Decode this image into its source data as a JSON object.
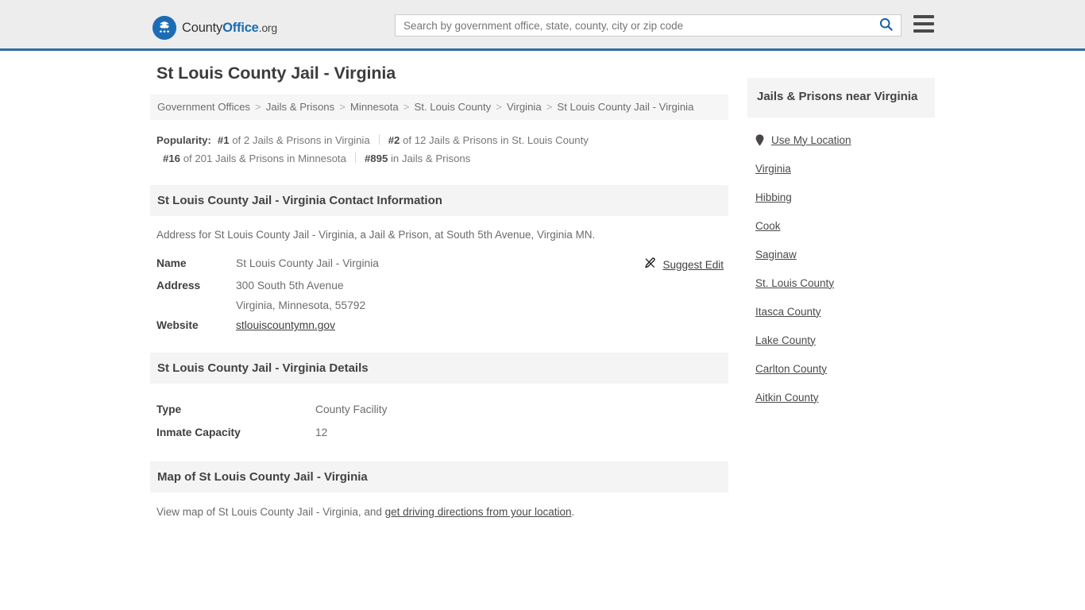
{
  "header": {
    "logo": {
      "icon": "eagle-seal-icon",
      "text_part1": "County",
      "text_part2": "Office",
      "text_part3": ".org"
    },
    "search": {
      "placeholder": "Search by government office, state, county, city or zip code",
      "value": "",
      "icon": "search-icon",
      "accent": "#1b6cb5"
    },
    "menu_icon": "hamburger-menu-icon",
    "background": "#ededed",
    "border_color": "#316fa3"
  },
  "page": {
    "title": "St Louis County Jail - Virginia"
  },
  "breadcrumb": {
    "separator": ">",
    "items": [
      {
        "label": "Government Offices",
        "current": false
      },
      {
        "label": "Jails & Prisons",
        "current": false
      },
      {
        "label": "Minnesota",
        "current": false
      },
      {
        "label": "St. Louis County",
        "current": false
      },
      {
        "label": "Virginia",
        "current": false
      },
      {
        "label": "St Louis County Jail - Virginia",
        "current": true
      }
    ]
  },
  "popularity": {
    "label": "Popularity:",
    "items": [
      {
        "rank": "#1",
        "text": "of 2 Jails & Prisons in Virginia"
      },
      {
        "rank": "#2",
        "text": "of 12 Jails & Prisons in St. Louis County"
      },
      {
        "rank": "#16",
        "text": "of 201 Jails & Prisons in Minnesota"
      },
      {
        "rank": "#895",
        "text": "in Jails & Prisons"
      }
    ]
  },
  "contact": {
    "heading": "St Louis County Jail - Virginia Contact Information",
    "intro": "Address for St Louis County Jail - Virginia, a Jail & Prison, at South 5th Avenue, Virginia MN.",
    "rows": [
      {
        "key": "Name",
        "value": "St Louis County Jail - Virginia",
        "is_link": false
      },
      {
        "key": "Address",
        "value": "300 South 5th Avenue",
        "is_link": false
      },
      {
        "key": "",
        "value": "Virginia, Minnesota, 55792",
        "is_link": false
      },
      {
        "key": "Website",
        "value": "stlouiscountymn.gov",
        "is_link": true
      }
    ],
    "suggest_edit": {
      "label": "Suggest Edit",
      "icon": "pencil-edit-icon"
    }
  },
  "details": {
    "heading": "St Louis County Jail - Virginia Details",
    "rows": [
      {
        "key": "Type",
        "value": "County Facility"
      },
      {
        "key": "Inmate Capacity",
        "value": "12"
      }
    ]
  },
  "map": {
    "heading": "Map of St Louis County Jail - Virginia",
    "text_before": "View map of St Louis County Jail - Virginia, and ",
    "link": "get driving directions from your location",
    "text_after": "."
  },
  "sidebar": {
    "heading": "Jails & Prisons near Virginia",
    "use_my_location": {
      "label": "Use My Location",
      "icon": "map-pin-icon"
    },
    "links": [
      {
        "label": "Virginia"
      },
      {
        "label": "Hibbing"
      },
      {
        "label": "Cook"
      },
      {
        "label": "Saginaw"
      },
      {
        "label": "St. Louis County"
      },
      {
        "label": "Itasca County"
      },
      {
        "label": "Lake County"
      },
      {
        "label": "Carlton County"
      },
      {
        "label": "Aitkin County"
      }
    ]
  }
}
